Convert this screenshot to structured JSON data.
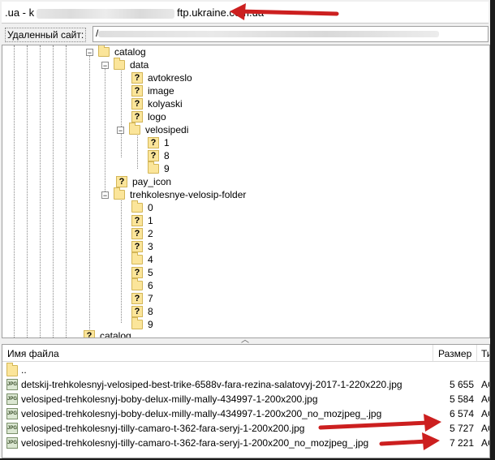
{
  "title_bar": {
    "prefix": ".ua - k",
    "host": "ftp.ukraine.com.ua"
  },
  "remote_site": {
    "label": "Удаленный сайт:",
    "path_start": "/"
  },
  "tree": {
    "catalog": "catalog",
    "data": "data",
    "data_children": [
      "avtokreslo",
      "image",
      "kolyaski",
      "logo"
    ],
    "velosipedi": "velosipedi",
    "velosipedi_children": [
      "1",
      "8",
      "9"
    ],
    "pay_icon": "pay_icon",
    "trehkolesnye": "trehkolesnye-velosip-folder",
    "trehkolesnye_children": [
      "0",
      "1",
      "2",
      "3",
      "4",
      "5",
      "6",
      "7",
      "8",
      "9"
    ],
    "catalog_partial": "catalog"
  },
  "file_list": {
    "col_name": "Имя файла",
    "col_size": "Размер",
    "col_type": "Ти",
    "parent": "..",
    "files": [
      {
        "name": "detskij-trehkolesnyj-velosiped-best-trike-6588v-fara-rezina-salatovyj-2017-1-220x220.jpg",
        "size": "5 655",
        "type": "AC"
      },
      {
        "name": "velosiped-trehkolesnyj-boby-delux-milly-mally-434997-1-200x200.jpg",
        "size": "5 584",
        "type": "AC"
      },
      {
        "name": "velosiped-trehkolesnyj-boby-delux-milly-mally-434997-1-200x200_no_mozjpeg_.jpg",
        "size": "6 574",
        "type": "AC"
      },
      {
        "name": "velosiped-trehkolesnyj-tilly-camaro-t-362-fara-seryj-1-200x200.jpg",
        "size": "5 727",
        "type": "AC"
      },
      {
        "name": "velosiped-trehkolesnyj-tilly-camaro-t-362-fara-seryj-1-200x200_no_mozjpeg_.jpg",
        "size": "7 221",
        "type": "AC"
      }
    ]
  },
  "colors": {
    "annotation_arrow": "#cc1f1f",
    "folder": "#fbe59a"
  }
}
